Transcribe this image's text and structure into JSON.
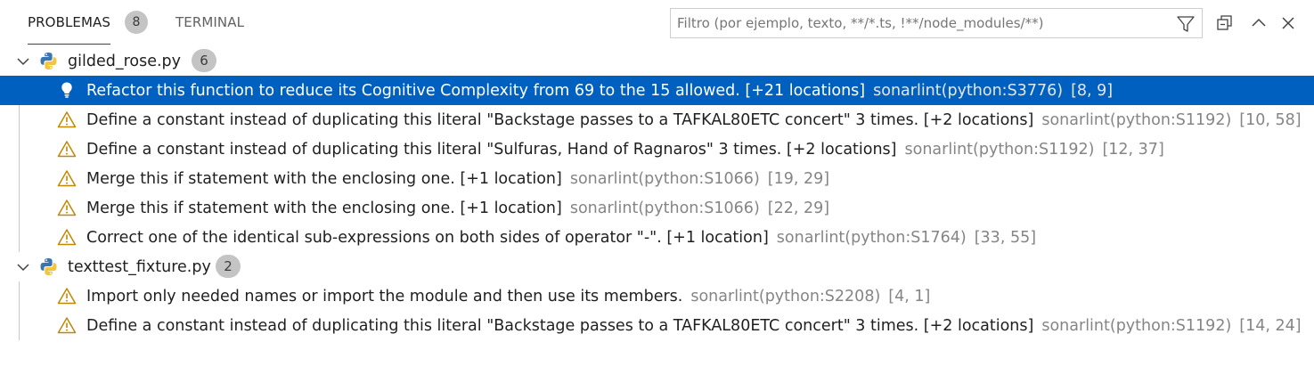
{
  "tabs": {
    "problems_label": "PROBLEMAS",
    "problems_count": "8",
    "terminal_label": "TERMINAL"
  },
  "filter": {
    "placeholder": "Filtro (por ejemplo, texto, **/*.ts, !**/node_modules/**)",
    "value": ""
  },
  "files": [
    {
      "name": "gilded_rose.py",
      "count": "6",
      "problems": [
        {
          "icon": "lightbulb-icon",
          "text": "Refactor this function to reduce its Cognitive Complexity from 69 to the 15 allowed. [+21 locations]",
          "source": "sonarlint(python:S3776)",
          "location": "[8, 9]",
          "selected": true
        },
        {
          "icon": "warning-icon",
          "text": "Define a constant instead of duplicating this literal \"Backstage passes to a TAFKAL80ETC concert\" 3 times. [+2 locations]",
          "source": "sonarlint(python:S1192)",
          "location": "[10, 58]"
        },
        {
          "icon": "warning-icon",
          "text": "Define a constant instead of duplicating this literal \"Sulfuras, Hand of Ragnaros\" 3 times. [+2 locations]",
          "source": "sonarlint(python:S1192)",
          "location": "[12, 37]"
        },
        {
          "icon": "warning-icon",
          "text": "Merge this if statement with the enclosing one. [+1 location]",
          "source": "sonarlint(python:S1066)",
          "location": "[19, 29]"
        },
        {
          "icon": "warning-icon",
          "text": "Merge this if statement with the enclosing one. [+1 location]",
          "source": "sonarlint(python:S1066)",
          "location": "[22, 29]"
        },
        {
          "icon": "warning-icon",
          "text": "Correct one of the identical sub-expressions on both sides of operator \"-\". [+1 location]",
          "source": "sonarlint(python:S1764)",
          "location": "[33, 55]"
        }
      ]
    },
    {
      "name": "texttest_fixture.py",
      "count": "2",
      "problems": [
        {
          "icon": "warning-icon",
          "text": "Import only needed names or import the module and then use its members.",
          "source": "sonarlint(python:S2208)",
          "location": "[4, 1]"
        },
        {
          "icon": "warning-icon",
          "text": "Define a constant instead of duplicating this literal \"Backstage passes to a TAFKAL80ETC concert\" 3 times. [+2 locations]",
          "source": "sonarlint(python:S1192)",
          "location": "[14, 24]"
        }
      ]
    }
  ],
  "colors": {
    "selection": "#0060c0",
    "warning": "#bf8803",
    "badge": "#c4c4c4"
  }
}
